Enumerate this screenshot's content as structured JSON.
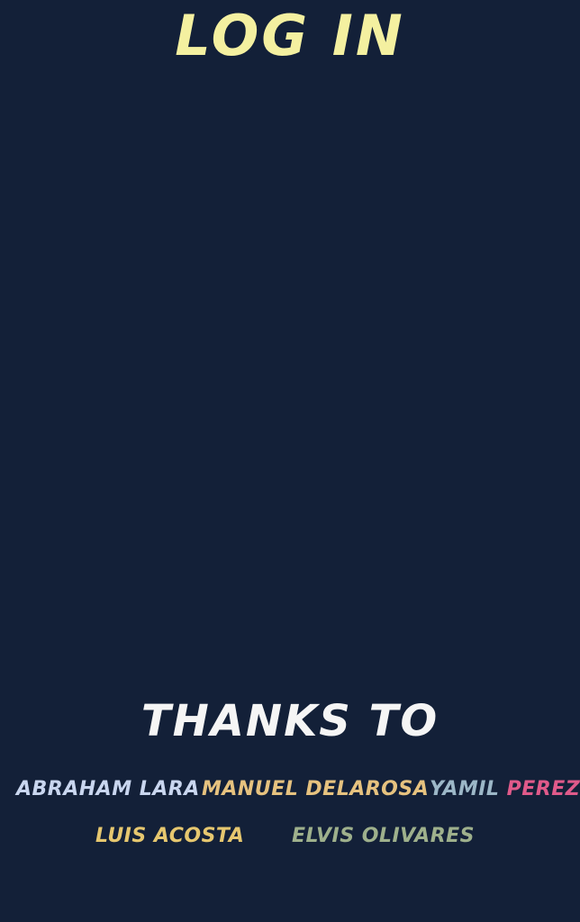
{
  "header": {
    "title": "LOG IN"
  },
  "credits": {
    "heading": "THANKS TO",
    "names": [
      {
        "text": "ABRAHAM LARA"
      },
      {
        "text": "MANUEL DELAROSA"
      },
      {
        "first": "YAMIL",
        "last": "PEREZ"
      },
      {
        "text": "LUIS ACOSTA"
      },
      {
        "text": "ELVIS OLIVARES"
      }
    ]
  },
  "colors": {
    "background": "#132038",
    "title": "#f4f0a0",
    "heading": "#f5f5f5",
    "name_abraham": "#c9d6ef",
    "name_manuel": "#e6c27f",
    "name_yamil_first": "#9cb7c7",
    "name_yamil_last": "#e05a8a",
    "name_luis": "#e6c76f",
    "name_elvis": "#9eb08c"
  }
}
